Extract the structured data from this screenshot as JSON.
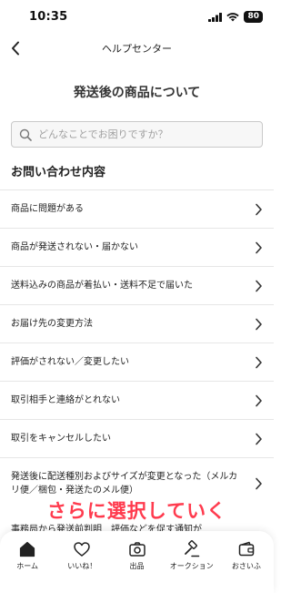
{
  "status_bar": {
    "time": "10:35",
    "battery": "80"
  },
  "nav": {
    "title": "ヘルプセンター"
  },
  "page": {
    "title": "発送後の商品について"
  },
  "search": {
    "placeholder": "どんなことでお困りですか？"
  },
  "section": {
    "title": "お問い合わせ内容"
  },
  "items": [
    {
      "label": "商品に問題がある"
    },
    {
      "label": "商品が発送されない・届かない"
    },
    {
      "label": "送料込みの商品が着払い・送料不足で届いた"
    },
    {
      "label": "お届け先の変更方法"
    },
    {
      "label": "評価がされない／変更したい"
    },
    {
      "label": "取引相手と連絡がとれない"
    },
    {
      "label": "取引をキャンセルしたい"
    },
    {
      "label": "発送後に配送種別およびサイズが変更となった（メルカリ便／梱包・発送たのメル便）"
    }
  ],
  "partial_item": "事務局から発送前判明　評価などを促す通知が",
  "overlay": {
    "caption": "さらに選択していく"
  },
  "tabs": [
    {
      "label": "ホーム",
      "icon": "home-icon"
    },
    {
      "label": "いいね！",
      "icon": "heart-icon"
    },
    {
      "label": "出品",
      "icon": "camera-icon"
    },
    {
      "label": "オークション",
      "icon": "gavel-icon"
    },
    {
      "label": "おさいふ",
      "icon": "wallet-icon"
    }
  ]
}
